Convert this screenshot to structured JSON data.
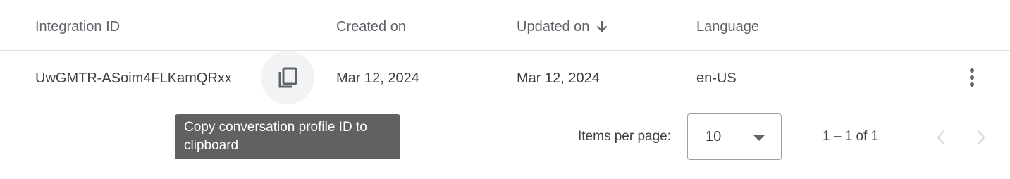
{
  "table": {
    "columns": [
      {
        "label": "Integration ID"
      },
      {
        "label": "Created on"
      },
      {
        "label": "Updated on",
        "sorted": "descending"
      },
      {
        "label": "Language"
      }
    ],
    "rows": [
      {
        "integration_id": "UwGMTR-ASoim4FLKamQRxx",
        "created_on": "Mar 12, 2024",
        "updated_on": "Mar 12, 2024",
        "language": "en-US"
      }
    ]
  },
  "tooltip": {
    "text": "Copy conversation profile ID to clipboard"
  },
  "paginator": {
    "items_per_page_label": "Items per page:",
    "page_size": "10",
    "range_label": "1 – 1 of 1"
  },
  "icons": {
    "copy": "content-copy-icon",
    "sort": "arrow-down-icon",
    "more": "more-vert-icon",
    "caret": "dropdown-caret-icon",
    "prev": "chevron-left-icon",
    "next": "chevron-right-icon"
  },
  "colors": {
    "tooltip_bg": "#616161",
    "header_text": "#5f6368",
    "body_text": "#3c4043",
    "disabled": "#dadce0"
  }
}
